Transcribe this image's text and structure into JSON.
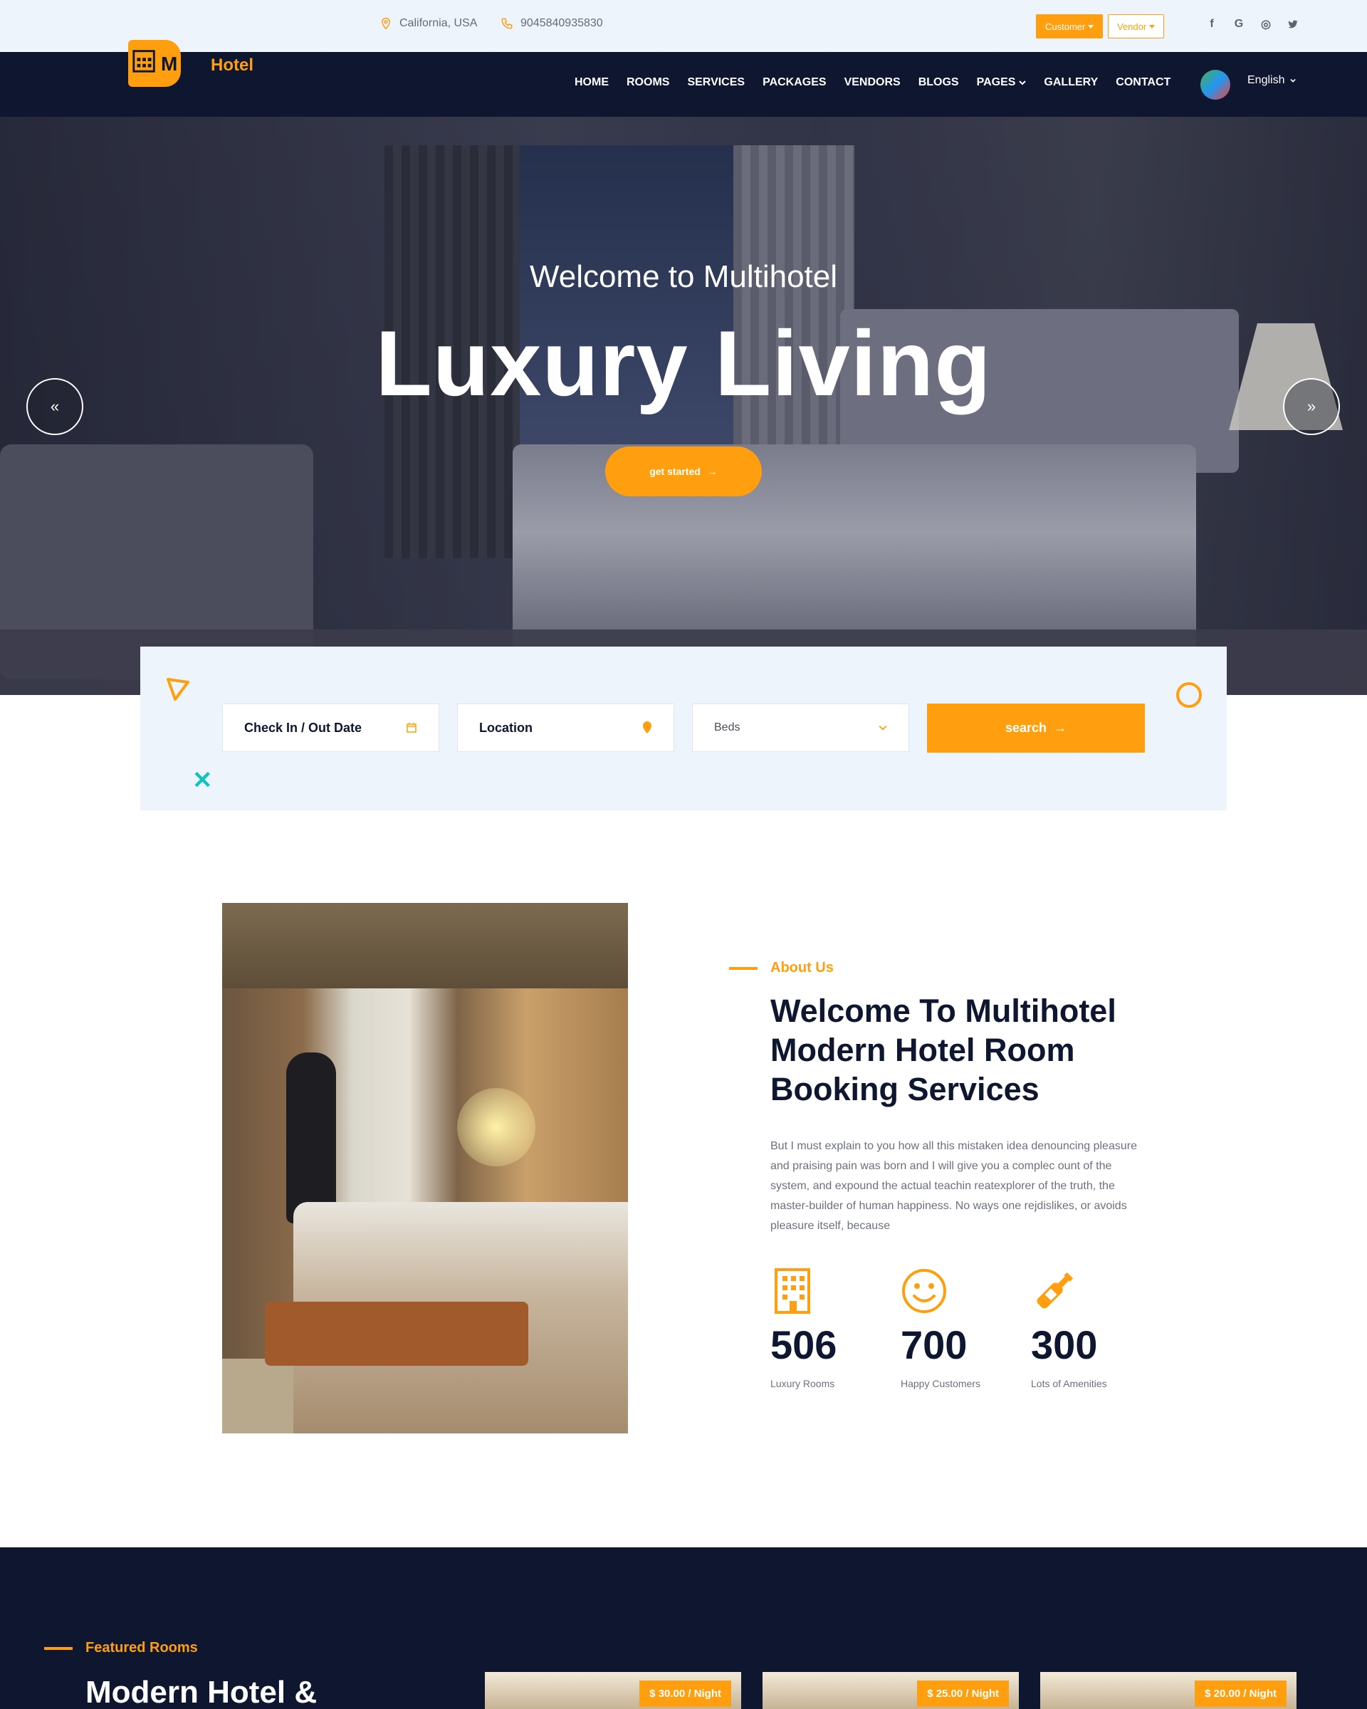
{
  "topbar": {
    "location": "California, USA",
    "phone": "9045840935830",
    "customer_label": "Customer",
    "vendor_label": "Vendor",
    "social": [
      "facebook-icon",
      "google-icon",
      "instagram-icon",
      "twitter-icon"
    ]
  },
  "nav": {
    "logo_text": "Hotel",
    "logo_letter": "M",
    "items": [
      "HOME",
      "ROOMS",
      "SERVICES",
      "PACKAGES",
      "VENDORS",
      "BLOGS",
      "PAGES",
      "GALLERY",
      "CONTACT"
    ],
    "language": "English"
  },
  "hero": {
    "subtitle": "Welcome to Multihotel",
    "title": "Luxury Living",
    "cta": "get started",
    "prev": "«",
    "next": "»"
  },
  "search": {
    "date_label": "Check In / Out Date",
    "location_label": "Location",
    "beds_label": "Beds",
    "button": "search"
  },
  "about": {
    "tag": "About Us",
    "title": "Welcome To Multihotel Modern Hotel Room Booking Services",
    "text": "But I must explain to you how all this mistaken idea denouncing pleasure and praising pain was born and I will give you a complec ount of the system, and expound the actual teachin reatexplorer of the truth, the master-builder of human happiness. No ways one rejdislikes, or avoids pleasure itself, because",
    "stats": [
      {
        "value": "506",
        "label": "Luxury Rooms",
        "icon": "building-icon"
      },
      {
        "value": "700",
        "label": "Happy Customers",
        "icon": "smiley-icon"
      },
      {
        "value": "300",
        "label": "Lots of Amenities",
        "icon": "bottle-icon"
      }
    ]
  },
  "featured": {
    "tag": "Featured Rooms",
    "title": "Modern Hotel &",
    "rooms": [
      {
        "price": "$ 30.00 / Night"
      },
      {
        "price": "$ 25.00 / Night"
      },
      {
        "price": "$ 20.00 / Night"
      }
    ]
  },
  "colors": {
    "accent": "#ff9f0f",
    "navy": "#0f1730",
    "light_bg": "#eef4fb",
    "teal": "#12c2c2"
  }
}
